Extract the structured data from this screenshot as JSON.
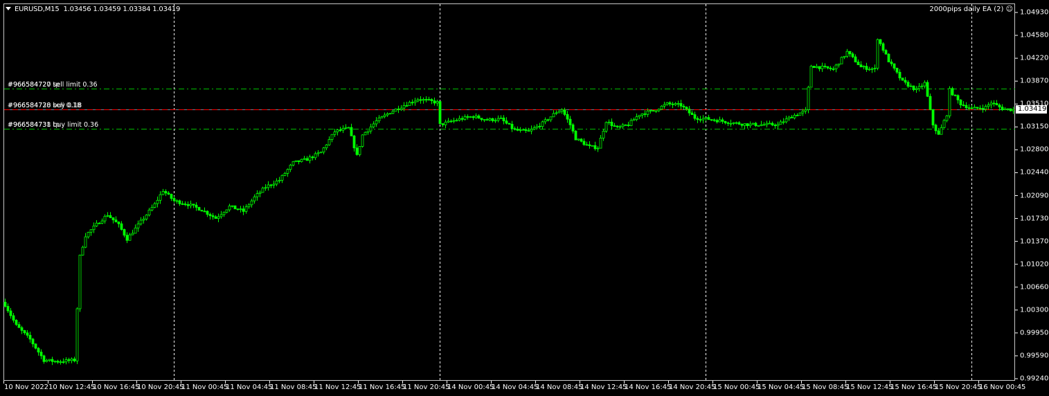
{
  "header": {
    "symbol_timeframe": "EURUSD,M15",
    "ohlc": "1.03456 1.03459 1.03384 1.03419"
  },
  "expert": {
    "label": "2000pips daily EA (2)",
    "icon": "smiley-icon"
  },
  "orders": [
    {
      "texts": [
        "#966584720 sell limit 0.36",
        "#966584727 tp"
      ],
      "price": 1.0375,
      "color": "#00c000"
    },
    {
      "texts": [
        "#966584728 buy 0.18",
        "#966584730 sell 0.18"
      ],
      "price": 1.03419,
      "color": "#ff0000"
    },
    {
      "texts": [
        "#966584731 buy limit 0.36",
        "#966584738 tp"
      ],
      "price": 1.0312,
      "color": "#00c000"
    }
  ],
  "current_price": "1.03419",
  "colors": {
    "candle": "#00ff00",
    "background": "#000000",
    "grid": "#ffffff",
    "order_line": "#00c000",
    "bid_line": "#ff0000"
  },
  "chart_data": {
    "type": "candlestick",
    "title": "EURUSD,M15",
    "ylim": [
      0.9924,
      1.0493
    ],
    "y_ticks": [
      "1.04930",
      "1.04580",
      "1.04220",
      "1.03870",
      "1.03510",
      "1.03150",
      "1.02800",
      "1.02440",
      "1.02090",
      "1.01730",
      "1.01370",
      "1.01020",
      "1.00660",
      "1.00300",
      "0.99950",
      "0.99590",
      "0.99240"
    ],
    "x_ticks": [
      "10 Nov 2022",
      "10 Nov 12:45",
      "10 Nov 16:45",
      "10 Nov 20:45",
      "11 Nov 00:45",
      "11 Nov 04:45",
      "11 Nov 08:45",
      "11 Nov 12:45",
      "11 Nov 16:45",
      "11 Nov 20:45",
      "14 Nov 00:45",
      "14 Nov 04:45",
      "14 Nov 08:45",
      "14 Nov 12:45",
      "14 Nov 16:45",
      "14 Nov 20:45",
      "15 Nov 00:45",
      "15 Nov 04:45",
      "15 Nov 08:45",
      "15 Nov 12:45",
      "15 Nov 16:45",
      "15 Nov 20:45",
      "16 Nov 00:45"
    ],
    "bars_per_x_tick": 16,
    "bar_count": 365,
    "day_separator_bars": [
      61,
      157,
      253,
      349
    ],
    "close_anchors": [
      [
        0,
        1.00389
      ],
      [
        4,
        1.00066
      ],
      [
        9,
        0.99851
      ],
      [
        14,
        0.99528
      ],
      [
        19,
        0.99507
      ],
      [
        25,
        0.99528
      ],
      [
        27,
        1.01142
      ],
      [
        29,
        1.01465
      ],
      [
        34,
        1.0168
      ],
      [
        37,
        1.01788
      ],
      [
        41,
        1.01627
      ],
      [
        44,
        1.01411
      ],
      [
        49,
        1.0168
      ],
      [
        54,
        1.01949
      ],
      [
        57,
        1.02165
      ],
      [
        61,
        1.02003
      ],
      [
        66,
        1.01949
      ],
      [
        71,
        1.01863
      ],
      [
        76,
        1.01734
      ],
      [
        81,
        1.01917
      ],
      [
        86,
        1.01842
      ],
      [
        90,
        1.02057
      ],
      [
        94,
        1.02218
      ],
      [
        99,
        1.02326
      ],
      [
        104,
        1.02595
      ],
      [
        109,
        1.02649
      ],
      [
        114,
        1.02756
      ],
      [
        119,
        1.03079
      ],
      [
        124,
        1.03133
      ],
      [
        127,
        1.02703
      ],
      [
        129,
        1.03025
      ],
      [
        134,
        1.03241
      ],
      [
        139,
        1.03381
      ],
      [
        144,
        1.03488
      ],
      [
        149,
        1.03585
      ],
      [
        152,
        1.03563
      ],
      [
        156,
        1.03531
      ],
      [
        157,
        1.03187
      ],
      [
        164,
        1.03273
      ],
      [
        169,
        1.03316
      ],
      [
        174,
        1.03262
      ],
      [
        179,
        1.03273
      ],
      [
        184,
        1.03101
      ],
      [
        189,
        1.03079
      ],
      [
        194,
        1.03208
      ],
      [
        199,
        1.03381
      ],
      [
        201,
        1.03424
      ],
      [
        204,
        1.03187
      ],
      [
        206,
        1.02972
      ],
      [
        211,
        1.02843
      ],
      [
        214,
        1.02832
      ],
      [
        217,
        1.03241
      ],
      [
        221,
        1.03133
      ],
      [
        225,
        1.03187
      ],
      [
        229,
        1.03348
      ],
      [
        234,
        1.03402
      ],
      [
        239,
        1.0351
      ],
      [
        244,
        1.03488
      ],
      [
        249,
        1.03294
      ],
      [
        254,
        1.03273
      ],
      [
        259,
        1.03241
      ],
      [
        264,
        1.03208
      ],
      [
        269,
        1.03187
      ],
      [
        274,
        1.03187
      ],
      [
        279,
        1.03187
      ],
      [
        284,
        1.03316
      ],
      [
        289,
        1.03402
      ],
      [
        291,
        1.04101
      ],
      [
        294,
        1.0408
      ],
      [
        299,
        1.04048
      ],
      [
        304,
        1.04317
      ],
      [
        309,
        1.0408
      ],
      [
        314,
        1.04048
      ],
      [
        315,
        1.04532
      ],
      [
        319,
        1.04177
      ],
      [
        324,
        1.03854
      ],
      [
        329,
        1.03725
      ],
      [
        332,
        1.03832
      ],
      [
        335,
        1.03187
      ],
      [
        337,
        1.03025
      ],
      [
        340,
        1.03348
      ],
      [
        341,
        1.03725
      ],
      [
        345,
        1.0351
      ],
      [
        349,
        1.03434
      ],
      [
        354,
        1.03456
      ],
      [
        356,
        1.03531
      ],
      [
        360,
        1.03434
      ],
      [
        364,
        1.03419
      ]
    ]
  }
}
